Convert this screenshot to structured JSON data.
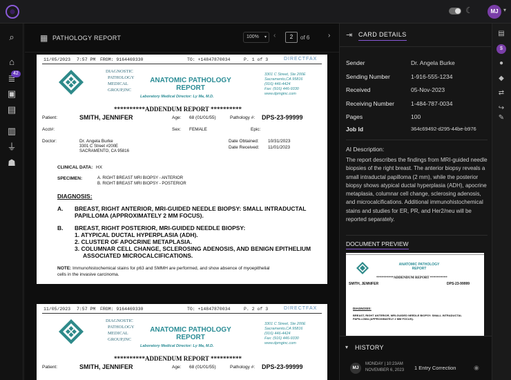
{
  "top": {
    "avatar": "MJ"
  },
  "nav": {
    "inbox_badge": "42"
  },
  "doc": {
    "header_title": "PATHOLOGY REPORT",
    "zoom": "100%",
    "page_current": "2",
    "page_total_text": "of 6"
  },
  "fax": {
    "date": "11/05/2023",
    "time": "7:57 PM",
    "from": "FROM: 9164469330",
    "to": "TO: +14847870034",
    "page1": "P. 1 of 3",
    "page2": "P. 2 of 3",
    "brand": "DIRECTFAX"
  },
  "report": {
    "logo_lines": [
      "DIAGNOSTIC",
      "PATHOLOGY",
      "MEDICAL",
      "GROUP,INC"
    ],
    "title_line1": "ANATOMIC PATHOLOGY",
    "title_line2": "REPORT",
    "lab_director": "Laboratory Medical Director: Ly Ma, M.D.",
    "addr_line1": "3301 C Street, Ste 200E",
    "addr_line2": "Sacramento,CA 95816",
    "addr_line3": "(916) 446-4424",
    "addr_line4": "Fax: (916) 446-9330",
    "addr_line5": "www.dpmginc.com",
    "addendum": "**********ADDENDUM REPORT **********",
    "patient_label": "Patient:",
    "patient_name": "SMITH, JENNIFER",
    "age_label": "Age:",
    "age_value": "68 (01/01/55)",
    "pathology_label": "Pathology #:",
    "pathology_value": "DPS-23-99999",
    "acct_label": "Acct#:",
    "sex_label": "Sex:",
    "sex_value": "FEMALE",
    "epic_label": "Epic:",
    "doctor_label": "Doctor:",
    "doctor_name": "Dr. Angela Burke",
    "doctor_addr1": "3301 C Street #200E",
    "doctor_addr2": "SACRAMENTO, CA 95816",
    "obtained_label": "Date Obtained:",
    "obtained_value": "10/31/2023",
    "received_label": "Date Received:",
    "received_value": "11/01/2023",
    "clinical_label": "CLINICAL DATA:",
    "clinical_value": "HX",
    "specimen_label": "SPECIMEN:",
    "specimen_a": "A. RIGHT BREAST MRI BIOPSY - ANTERIOR",
    "specimen_b": "B. RIGHT BREAST MRI BIOPSY - POSTERIOR",
    "diagnosis_label": "DIAGNOSIS:",
    "dx_a_letter": "A.",
    "dx_a_line1": "BREAST, RIGHT ANTERIOR, MRI-GUIDED NEEDLE BIOPSY: SMALL INTRADUCTAL",
    "dx_a_line2": "PAPILLOMA (APPROXIMATELY 2 MM FOCUS).",
    "dx_b_letter": "B.",
    "dx_b_line1": "BREAST, RIGHT POSTERIOR, MRI-GUIDED NEEDLE BIOPSY:",
    "dx_b_1": "1.  ATYPICAL DUCTAL HYPERPLASIA (ADH).",
    "dx_b_2": "2.  CLUSTER OF APOCRINE METAPLASIA.",
    "dx_b_3a": "3.  COLUMNAR CELL CHANGE, SCLEROSING ADENOSIS, AND BENIGN EPITHELIUM",
    "dx_b_3b": "ASSOCIATED MICROCALCIFICATIONS.",
    "note_label": "NOTE:",
    "note_line1": "Immunohistochemical stains for p63 and SMMH are performed, and show absence of myoepithelial",
    "note_line2": "cells in the invasive carcinoma."
  },
  "card": {
    "title": "CARD DETAILS",
    "sender_label": "Sender",
    "sender_value": "Dr. Angela Burke",
    "sending_label": "Sending Number",
    "sending_value": "1-916-555-1234",
    "received_label": "Received",
    "received_value": "05-Nov-2023",
    "receiving_label": "Receiving Number",
    "receiving_value": "1-484-787-0034",
    "pages_label": "Pages",
    "pages_value": "100",
    "jobid_label": "Job Id",
    "jobid_value": "364c69492-d295-44be-b976",
    "ai_label": "AI Description:",
    "ai_text": "The report describes the findings from MRI-guided needle biopsies of the right breast. The anterior biopsy reveals a small intraductal papilloma (2 mm), while the posterior biopsy shows atypical ductal hyperplasia (ADH), apocrine metaplasia, columnar cell change, sclerosing adenosis, and microcalcifications. Additional immunohistochemical stains and studies for ER, PR, and Her2/neu will be reported separately.",
    "preview_label": "DOCUMENT PREVIEW",
    "preview_dx_a": "BREAST, RIGHT ANTERIOR, MRI-GUIDED NEEDLE BIOPSY: SMALL INTRADUCTAL",
    "preview_dx_a2": "PAPILLOMA (APPROXIMATELY 2 MM FOCUS)."
  },
  "history": {
    "title": "HISTORY",
    "avatar": "MJ",
    "date_line1": "MONDAY | 10:23AM",
    "date_line2": "NOVEMBER 6, 2023",
    "event": "1 Entry Correction"
  },
  "colors": {
    "accent": "#8a5ad8",
    "teal": "#2a8c95",
    "fax_blue": "#5a8fb8"
  }
}
